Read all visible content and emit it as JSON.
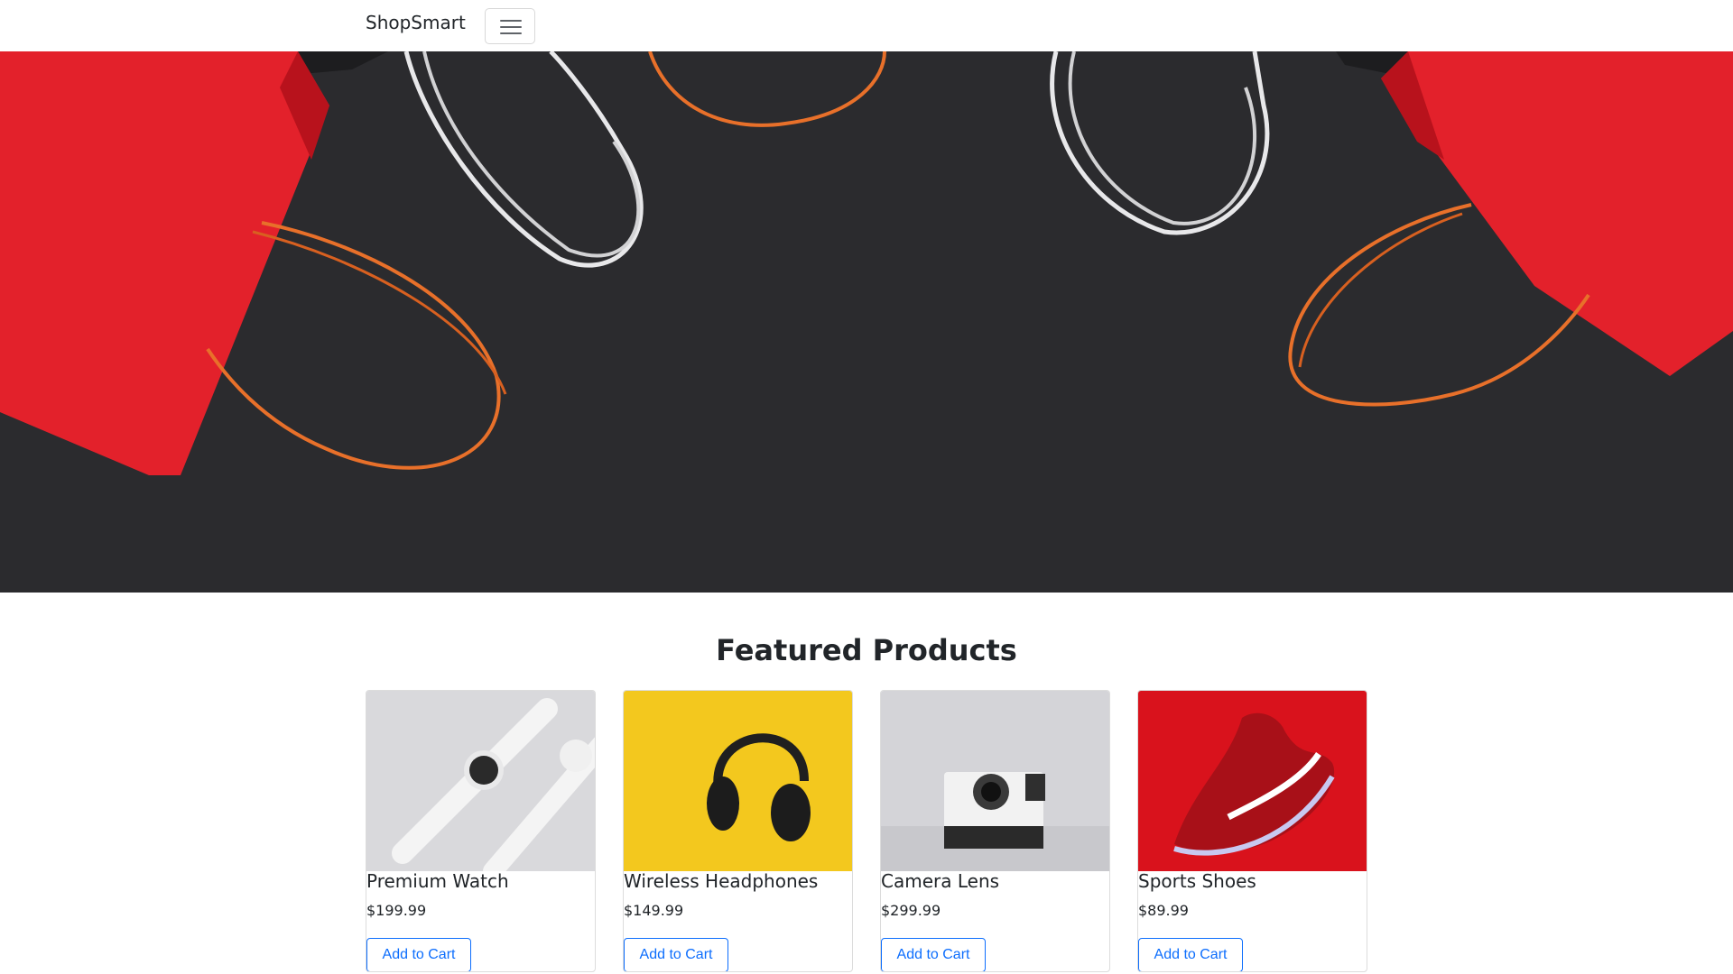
{
  "navbar": {
    "brand": "ShopSmart",
    "toggler_icon": "hamburger-icon"
  },
  "featured": {
    "title": "Featured Products",
    "products": [
      {
        "name": "Premium Watch",
        "price": "$199.99",
        "button": "Add to Cart"
      },
      {
        "name": "Wireless Headphones",
        "price": "$149.99",
        "button": "Add to Cart"
      },
      {
        "name": "Camera Lens",
        "price": "$299.99",
        "button": "Add to Cart"
      },
      {
        "name": "Sports Shoes",
        "price": "$89.99",
        "button": "Add to Cart"
      }
    ]
  },
  "colors": {
    "accent": "#0d6efd",
    "hero_background": "#2a2a2d",
    "bag_red": "#e3212b",
    "string_orange": "#e8702a"
  }
}
